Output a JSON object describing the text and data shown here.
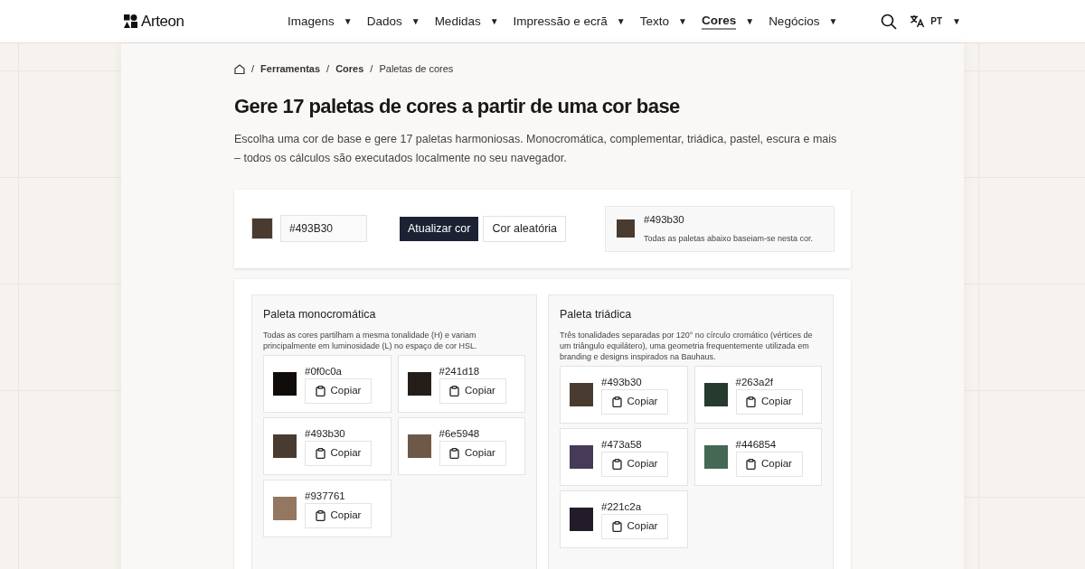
{
  "brand": "Arteon",
  "nav": [
    {
      "label": "Imagens",
      "selected": false
    },
    {
      "label": "Dados",
      "selected": false
    },
    {
      "label": "Medidas",
      "selected": false
    },
    {
      "label": "Impressão e ecrã",
      "selected": false
    },
    {
      "label": "Texto",
      "selected": false
    },
    {
      "label": "Cores",
      "selected": true
    },
    {
      "label": "Negócios",
      "selected": false
    }
  ],
  "caret": "▼",
  "language": "PT",
  "breadcrumb": [
    "Ferramentas",
    "Cores",
    "Paletas de cores"
  ],
  "breadcrumb_separator": "/",
  "title": "Gere 17 paletas de cores a partir de uma cor base",
  "intro": "Escolha uma cor de base e gere 17 paletas harmoniosas. Monocromática, complementar, triádica, pastel, escura e mais – todos os cálculos são executados localmente no seu navegador.",
  "picker": {
    "color": "#493b30",
    "value": "#493B30",
    "update_button": "Atualizar cor",
    "random_button": "Cor aleatória",
    "current_hex": "#493b30",
    "current_note": "Todas as paletas abaixo baseiam-se nesta cor."
  },
  "palettes": [
    {
      "title": "Paleta monocromática",
      "description": "Todas as cores partilham a mesma tonalidade (H) e variam principalmente em luminosidade (L) no espaço de cor HSL.",
      "swatches": [
        {
          "hex": "#0f0c0a",
          "color": "#0f0c0a",
          "copy": "Copiar"
        },
        {
          "hex": "#241d18",
          "color": "#241d18",
          "copy": "Copiar"
        },
        {
          "hex": "#493b30",
          "color": "#493b30",
          "copy": "Copiar"
        },
        {
          "hex": "#6e5948",
          "color": "#6e5948",
          "copy": "Copiar"
        },
        {
          "hex": "#937761",
          "color": "#937761",
          "copy": "Copiar"
        }
      ]
    },
    {
      "title": "Paleta triádica",
      "description": "Três tonalidades separadas por 120° no círculo cromático (vértices de um triângulo equilátero), uma geometria frequentemente utilizada em branding e designs inspirados na Bauhaus.",
      "swatches": [
        {
          "hex": "#493b30",
          "color": "#493b30",
          "copy": "Copiar"
        },
        {
          "hex": "#263a2f",
          "color": "#263a2f",
          "copy": "Copiar"
        },
        {
          "hex": "#473a58",
          "color": "#473a58",
          "copy": "Copiar"
        },
        {
          "hex": "#446854",
          "color": "#446854",
          "copy": "Copiar"
        },
        {
          "hex": "#221c2a",
          "color": "#221c2a",
          "copy": "Copiar"
        }
      ]
    }
  ]
}
